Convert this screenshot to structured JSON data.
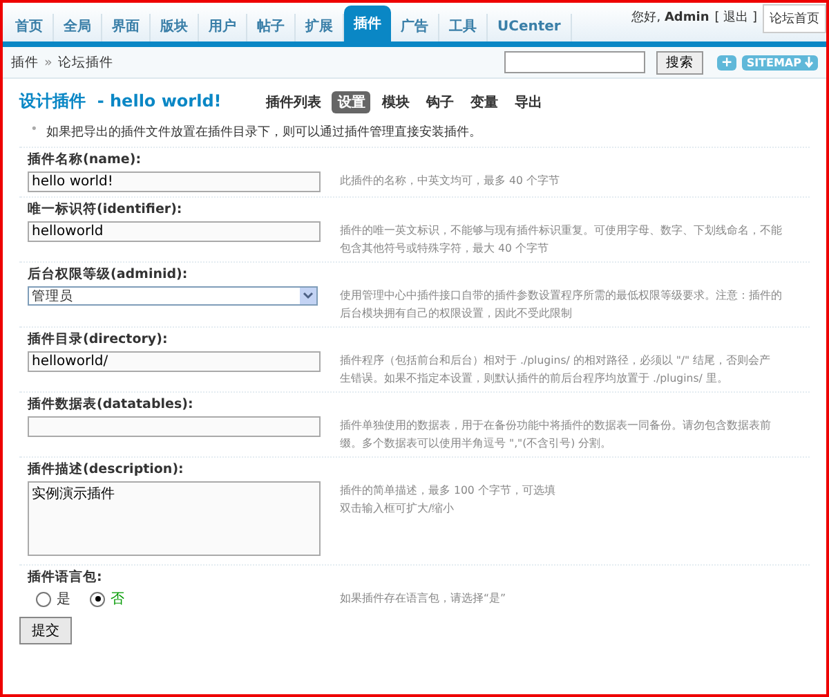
{
  "nav": {
    "items": [
      {
        "label": "首页",
        "selected": false
      },
      {
        "label": "全局",
        "selected": false
      },
      {
        "label": "界面",
        "selected": false
      },
      {
        "label": "版块",
        "selected": false
      },
      {
        "label": "用户",
        "selected": false
      },
      {
        "label": "帖子",
        "selected": false
      },
      {
        "label": "扩展",
        "selected": false
      },
      {
        "label": "插件",
        "selected": true
      },
      {
        "label": "广告",
        "selected": false
      },
      {
        "label": "工具",
        "selected": false
      },
      {
        "label": "UCenter",
        "selected": false
      }
    ],
    "greeting": "您好,",
    "user": "Admin",
    "logout": "[ 退出 ]",
    "home_link": "论坛首页"
  },
  "breadcrumb": {
    "items": [
      "插件",
      "论坛插件"
    ],
    "separator": "»"
  },
  "search": {
    "button": "搜索"
  },
  "toolbar": {
    "add": "+",
    "sitemap": "SITEMAP"
  },
  "page": {
    "title": "设计插件",
    "subtitle": "- hello world!",
    "tabs": [
      {
        "label": "插件列表",
        "selected": false
      },
      {
        "label": "设置",
        "selected": true
      },
      {
        "label": "模块",
        "selected": false
      },
      {
        "label": "钩子",
        "selected": false
      },
      {
        "label": "变量",
        "selected": false
      },
      {
        "label": "导出",
        "selected": false
      }
    ]
  },
  "note_bullet": "•",
  "note": "如果把导出的插件文件放置在插件目录下，则可以通过插件管理直接安装插件。",
  "fields": [
    {
      "kind": "text",
      "label": "插件名称(name):",
      "value": "hello world!",
      "description": [
        "此插件的名称，中英文均可，最多 40 个字节"
      ]
    },
    {
      "kind": "text",
      "label": "唯一标识符(identifier):",
      "value": "helloworld",
      "description": [
        "插件的唯一英文标识，不能够与现有插件标识重复。可使用字母、数字、下划线命名，不能",
        "包含其他符号或特殊字符，最大 40 个字节"
      ]
    },
    {
      "kind": "select",
      "label": "后台权限等级(adminid):",
      "value": "管理员",
      "description": [
        "使用管理中心中插件接口自带的插件参数设置程序所需的最低权限等级要求。注意：插件的",
        "后台模块拥有自己的权限设置，因此不受此限制"
      ]
    },
    {
      "kind": "text",
      "label": "插件目录(directory):",
      "value": "helloworld/",
      "description": [
        "插件程序（包括前台和后台）相对于 ./plugins/ 的相对路径，必须以 \"/\" 结尾，否则会产",
        "生错误。如果不指定本设置，则默认插件的前后台程序均放置于 ./plugins/ 里。"
      ]
    },
    {
      "kind": "text",
      "label": "插件数据表(datatables):",
      "description": [
        "插件单独使用的数据表，用于在备份功能中将插件的数据表一同备份。请勿包含数据表前",
        "缀。多个数据表可以使用半角逗号 \",\"(不含引号) 分割。"
      ]
    },
    {
      "kind": "textarea",
      "label": "插件描述(description):",
      "value": "实例演示插件",
      "description": [
        "插件的简单描述，最多 100 个字节，可选填",
        "双击输入框可扩大/缩小"
      ]
    },
    {
      "kind": "radio",
      "label": "插件语言包:",
      "options": [
        {
          "label": "是",
          "selected": false
        },
        {
          "label": "否",
          "selected": true
        }
      ],
      "description": [
        "如果插件存在语言包，请选择“是”"
      ]
    }
  ],
  "submit": "提交"
}
